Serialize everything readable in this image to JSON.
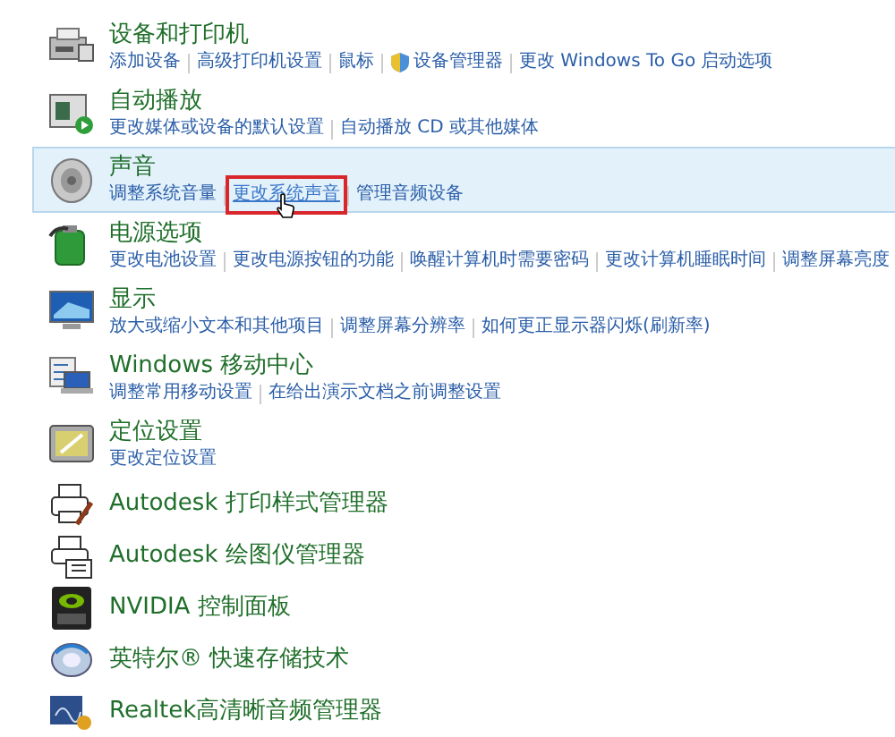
{
  "items": [
    {
      "kind": "devices",
      "title": "设备和打印机",
      "selected": false,
      "links": [
        {
          "text": "添加设备",
          "admin": false,
          "highlighted": false
        },
        {
          "text": "高级打印机设置",
          "admin": false,
          "highlighted": false
        },
        {
          "text": "鼠标",
          "admin": false,
          "highlighted": false
        },
        {
          "text": "设备管理器",
          "admin": true,
          "highlighted": false
        },
        {
          "text": "更改 Windows To Go 启动选项",
          "admin": false,
          "highlighted": false
        }
      ]
    },
    {
      "kind": "autoplay",
      "title": "自动播放",
      "selected": false,
      "links": [
        {
          "text": "更改媒体或设备的默认设置",
          "admin": false,
          "highlighted": false
        },
        {
          "text": "自动播放 CD 或其他媒体",
          "admin": false,
          "highlighted": false
        }
      ]
    },
    {
      "kind": "speaker",
      "title": "声音",
      "selected": true,
      "links": [
        {
          "text": "调整系统音量",
          "admin": false,
          "highlighted": false
        },
        {
          "text": "更改系统声音",
          "admin": false,
          "highlighted": true
        },
        {
          "text": "管理音频设备",
          "admin": false,
          "highlighted": false
        }
      ]
    },
    {
      "kind": "power",
      "title": "电源选项",
      "selected": false,
      "links": [
        {
          "text": "更改电池设置",
          "admin": false,
          "highlighted": false
        },
        {
          "text": "更改电源按钮的功能",
          "admin": false,
          "highlighted": false
        },
        {
          "text": "唤醒计算机时需要密码",
          "admin": false,
          "highlighted": false
        },
        {
          "text": "更改计算机睡眠时间",
          "admin": false,
          "highlighted": false
        },
        {
          "text": "调整屏幕亮度",
          "admin": false,
          "highlighted": false
        }
      ]
    },
    {
      "kind": "display",
      "title": "显示",
      "selected": false,
      "links": [
        {
          "text": "放大或缩小文本和其他项目",
          "admin": false,
          "highlighted": false
        },
        {
          "text": "调整屏幕分辨率",
          "admin": false,
          "highlighted": false
        },
        {
          "text": "如何更正显示器闪烁(刷新率)",
          "admin": false,
          "highlighted": false
        }
      ]
    },
    {
      "kind": "mobility",
      "title": "Windows 移动中心",
      "selected": false,
      "links": [
        {
          "text": "调整常用移动设置",
          "admin": false,
          "highlighted": false
        },
        {
          "text": "在给出演示文档之前调整设置",
          "admin": false,
          "highlighted": false
        }
      ]
    },
    {
      "kind": "location",
      "title": "定位设置",
      "selected": false,
      "links": [
        {
          "text": "更改定位设置",
          "admin": false,
          "highlighted": false
        }
      ]
    },
    {
      "kind": "printer",
      "title": "Autodesk 打印样式管理器",
      "selected": false
    },
    {
      "kind": "plotter",
      "title": "Autodesk 绘图仪管理器",
      "selected": false
    },
    {
      "kind": "gpu",
      "title": "NVIDIA 控制面板",
      "selected": false
    },
    {
      "kind": "storage",
      "title": "英特尔® 快速存储技术",
      "selected": false
    },
    {
      "kind": "audio",
      "title": "Realtek高清晰音频管理器",
      "selected": false
    }
  ]
}
